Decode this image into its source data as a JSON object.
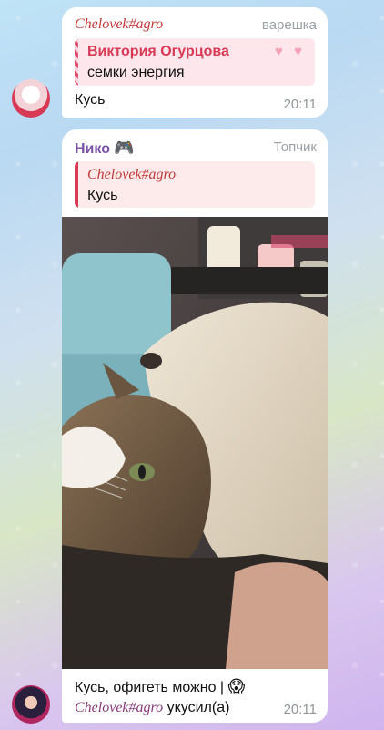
{
  "messages": [
    {
      "sender": "Chelovek#agro",
      "rank": "варешка",
      "reply": {
        "name": "Виктория Огурцова",
        "text": "семки энергия",
        "decoration": "♥ ♥"
      },
      "text": "Кусь",
      "time": "20:11"
    },
    {
      "sender": "Нико",
      "sender_icon": "🎮",
      "rank": "Топчик",
      "reply": {
        "name": "Chelovek#agro",
        "text": "Кусь"
      },
      "caption_main": "Кусь, офигеть можно | ",
      "caption_emoji": "😱",
      "caption_name": "Chelovek#agro",
      "caption_tail": " укусил(а)",
      "time": "20:11"
    }
  ]
}
